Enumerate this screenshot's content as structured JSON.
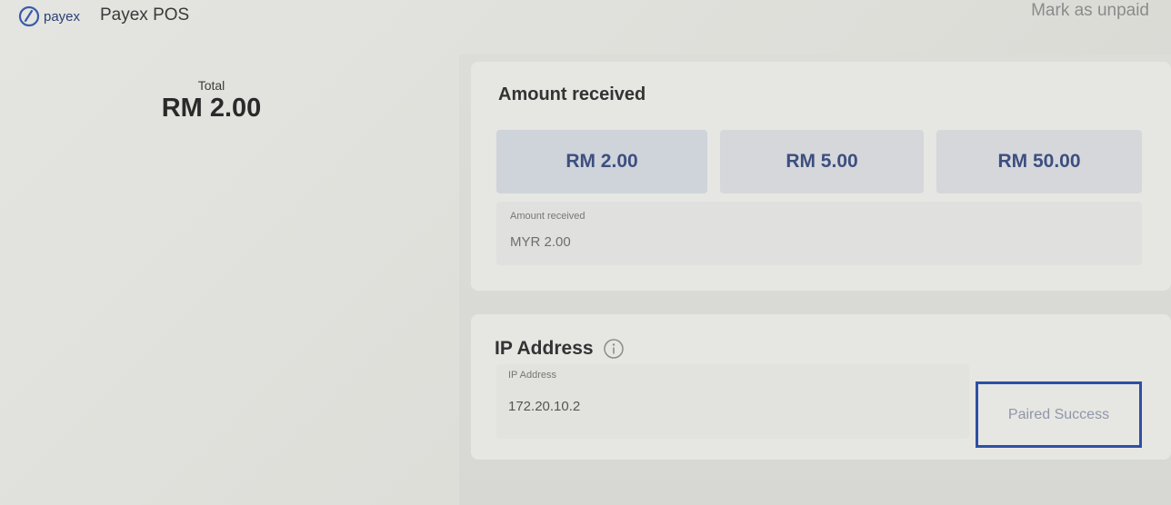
{
  "header": {
    "logo_word": "payex",
    "app_title": "Payex POS",
    "mark_unpaid_label": "Mark as unpaid"
  },
  "total": {
    "label": "Total",
    "value": "RM 2.00"
  },
  "amount_received": {
    "title": "Amount received",
    "options": [
      "RM 2.00",
      "RM 5.00",
      "RM 50.00"
    ],
    "selected_index": 0,
    "field_label": "Amount received",
    "field_value": "MYR 2.00"
  },
  "ip": {
    "title": "IP Address",
    "field_label": "IP Address",
    "field_value": "172.20.10.2",
    "status": "Paired Success"
  },
  "colors": {
    "brand": "#2b3f73",
    "button_text": "#3d4f80",
    "highlight_border": "#2e4fa3"
  },
  "icons": {
    "logo": "payex-logo-icon",
    "info": "info-icon"
  }
}
